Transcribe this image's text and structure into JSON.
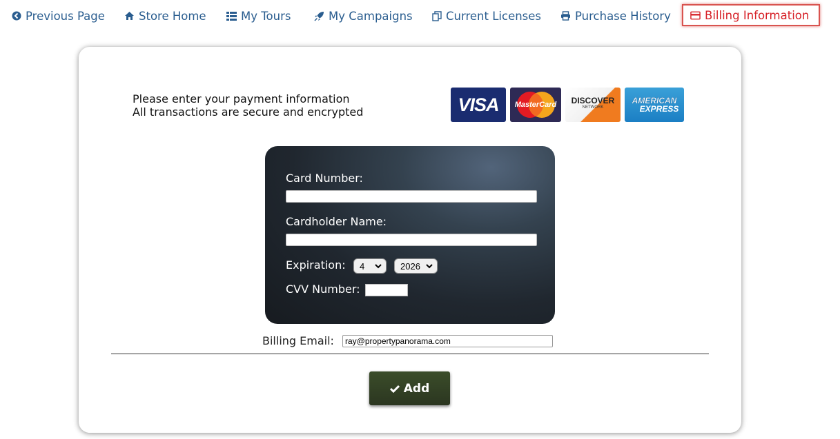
{
  "nav": {
    "previous_page": "Previous Page",
    "store_home": "Store Home",
    "my_tours": "My Tours",
    "my_campaigns": "My Campaigns",
    "current_licenses": "Current Licenses",
    "purchase_history": "Purchase History",
    "billing_information": "Billing Information"
  },
  "intro": {
    "heading": "Please enter your payment information",
    "subheading": "All transactions are secure and encrypted"
  },
  "logos": {
    "visa": "VISA",
    "mastercard": "MasterCard",
    "discover": "DISCOVER",
    "discover_sub": "NETWORK",
    "amex_line1": "AMERICAN",
    "amex_line2": "EXPRESS"
  },
  "form": {
    "card_number_label": "Card Number:",
    "card_number_value": "",
    "cardholder_label": "Cardholder Name:",
    "cardholder_value": "",
    "expiration_label": "Expiration:",
    "exp_month": "4",
    "exp_year": "2026",
    "cvv_label": "CVV Number:",
    "cvv_value": "",
    "billing_email_label": "Billing Email:",
    "billing_email_value": "ray@propertypanorama.com"
  },
  "actions": {
    "add_label": "Add"
  },
  "colors": {
    "nav_link": "#2a5d8f",
    "nav_active": "#d61f26",
    "add_button": "#34432a"
  }
}
